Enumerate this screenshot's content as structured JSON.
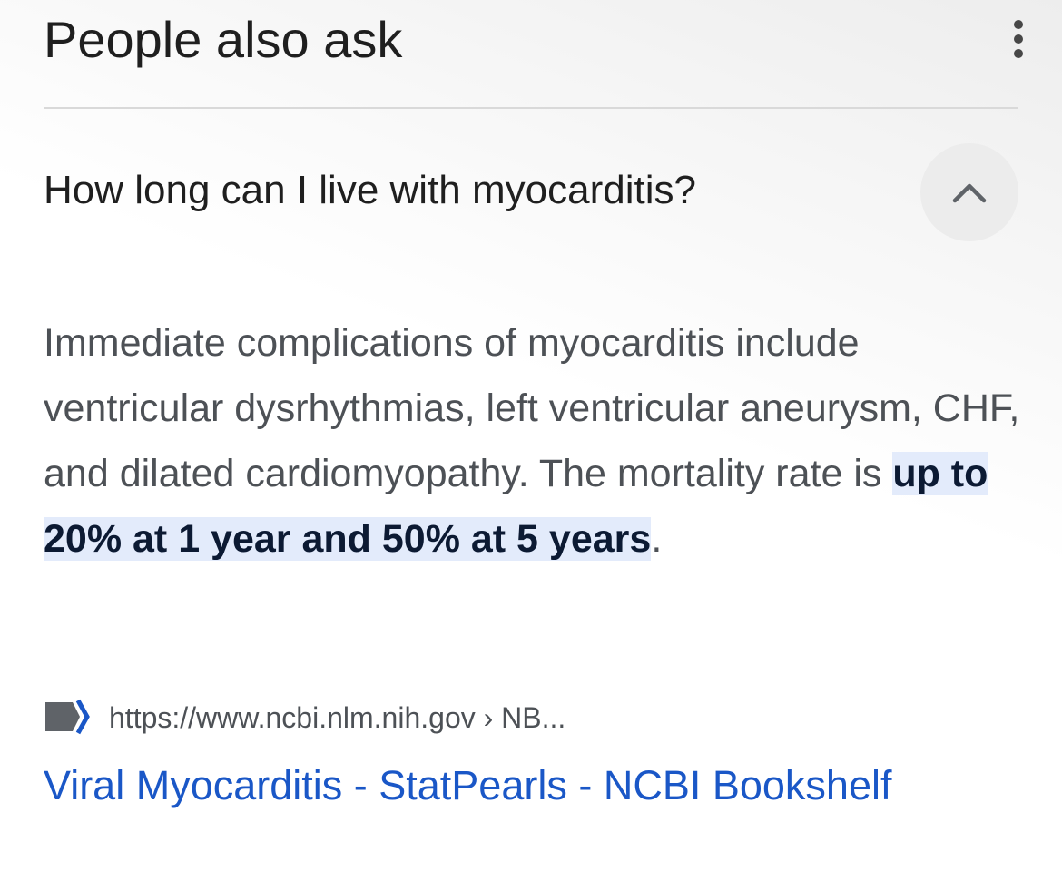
{
  "header": {
    "title": "People also ask",
    "more_icon": "more-vert-icon"
  },
  "question": {
    "text": "How long can I live with myocarditis?",
    "toggle_icon": "chevron-up-icon",
    "expanded": true
  },
  "answer": {
    "text_before": "Immediate complications of myocarditis include ventricular dysrhythmias, left ventricular aneurysm, CHF, and dilated cardiomyopathy. The mortality rate is ",
    "highlight": "up to 20% at 1 year and 50% at 5 years",
    "text_after": "."
  },
  "source": {
    "icon": "bookshelf-favicon-icon",
    "url": "https://www.ncbi.nlm.nih.gov › NB...",
    "title": "Viral Myocarditis - StatPearls - NCBI Bookshelf"
  },
  "colors": {
    "link": "#1a57c7",
    "highlight_bg": "#e3ebfb",
    "text_secondary": "#4d5156",
    "text_primary": "#1f1f1f"
  }
}
